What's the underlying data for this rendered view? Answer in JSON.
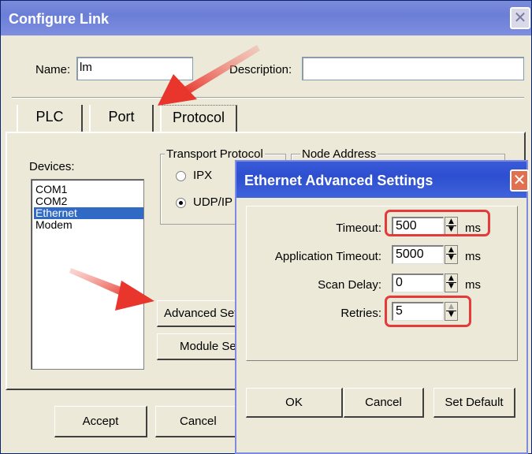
{
  "main": {
    "title": "Configure Link",
    "close_glyph": "✕",
    "name_label": "Name:",
    "name_value": "lm",
    "description_label": "Description:",
    "description_value": "",
    "tabs": [
      {
        "label": "PLC"
      },
      {
        "label": "Port"
      },
      {
        "label": "Protocol"
      }
    ],
    "devices_label": "Devices:",
    "devices": [
      "COM1",
      "COM2",
      "Ethernet",
      "Modem"
    ],
    "selected_device": "Ethernet",
    "transport_protocol_label": "Transport Protocol",
    "node_address_label": "Node Address",
    "radio_ipx": "IPX",
    "radio_udp": "UDP/IP",
    "advanced_settings_button": "Advanced Settings",
    "module_settings_button": "Module Settings",
    "accept_button": "Accept",
    "cancel_button": "Cancel"
  },
  "sub": {
    "title": "Ethernet Advanced Settings",
    "close_glyph": "✕",
    "fields": [
      {
        "label": "Timeout:",
        "value": "500",
        "unit": "ms"
      },
      {
        "label": "Application Timeout:",
        "value": "5000",
        "unit": "ms"
      },
      {
        "label": "Scan Delay:",
        "value": "0",
        "unit": "ms"
      },
      {
        "label": "Retries:",
        "value": "5",
        "unit": ""
      }
    ],
    "ok_button": "OK",
    "cancel_button": "Cancel",
    "set_default_button": "Set Default"
  },
  "icons": {
    "spinner_up": "▲",
    "spinner_down": "▼"
  },
  "colors": {
    "highlight": "#e53a3a",
    "selection": "#316ac5",
    "arrow": "#e8362d"
  }
}
